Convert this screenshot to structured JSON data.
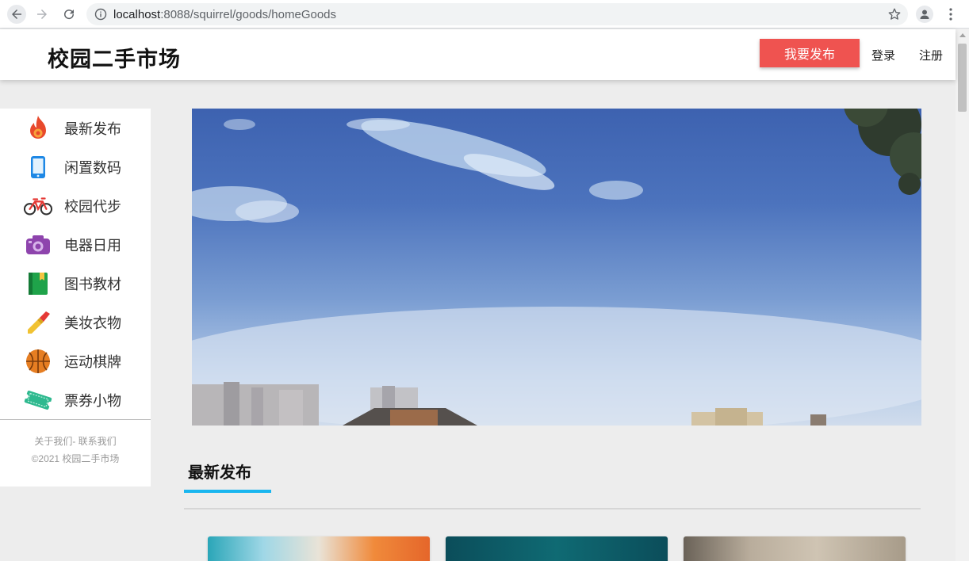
{
  "browser": {
    "url_host": "localhost",
    "url_rest": ":8088/squirrel/goods/homeGoods"
  },
  "header": {
    "title": "校园二手市场",
    "publish_label": "我要发布",
    "login_label": "登录",
    "register_label": "注册"
  },
  "sidebar": {
    "items": [
      {
        "label": "最新发布",
        "icon": "flame-icon"
      },
      {
        "label": "闲置数码",
        "icon": "phone-icon"
      },
      {
        "label": "校园代步",
        "icon": "bicycle-icon"
      },
      {
        "label": "电器日用",
        "icon": "camera-icon"
      },
      {
        "label": "图书教材",
        "icon": "book-icon"
      },
      {
        "label": "美妆衣物",
        "icon": "lipstick-icon"
      },
      {
        "label": "运动棋牌",
        "icon": "basketball-icon"
      },
      {
        "label": "票券小物",
        "icon": "ticket-icon"
      }
    ],
    "footer_links": "关于我们- 联系我们",
    "footer_copy": "©2021 校园二手市场"
  },
  "section": {
    "title": "最新发布"
  },
  "colors": {
    "publish_button": "#ef5350",
    "section_accent": "#1ab6ef"
  }
}
